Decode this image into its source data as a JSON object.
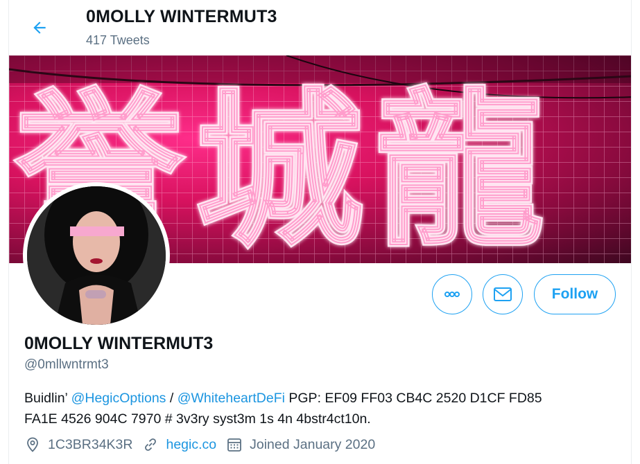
{
  "header": {
    "name": "0MOLLY WINTERMUT3",
    "tweet_count": "417 Tweets"
  },
  "banner": {
    "neon_text": "誉城龍"
  },
  "actions": {
    "follow_label": "Follow"
  },
  "profile": {
    "name": "0MOLLY WINTERMUT3",
    "handle": "@0mllwntrmt3",
    "bio": {
      "prefix": "Buidlin’ ",
      "mention1": "@HegicOptions",
      "sep": " / ",
      "mention2": "@WhiteheartDeFi",
      "rest_line1": " PGP: EF09 FF03 CB4C 2520 D1CF FD85",
      "line2": "FA1E 4526 904C 7970 # 3v3ry syst3m 1s 4n 4bstr4ct10n."
    },
    "location": "1C3BR34K3R",
    "website": "hegic.co",
    "joined": "Joined January 2020"
  },
  "colors": {
    "accent": "#1da1f2",
    "link": "#1b95e0",
    "muted": "#5b7083",
    "banner": "#e0156a"
  }
}
